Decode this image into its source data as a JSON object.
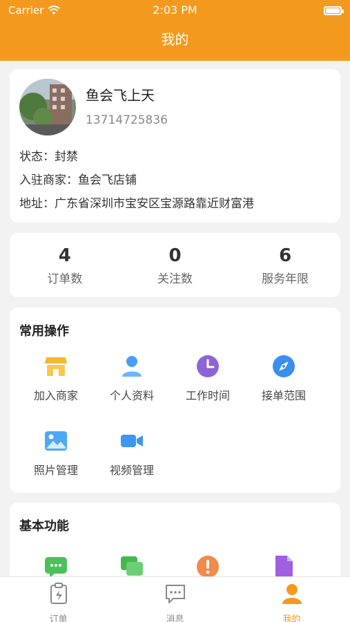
{
  "status_bar": {
    "carrier": "Carrier",
    "time": "2:03 PM"
  },
  "nav": {
    "title": "我的"
  },
  "profile": {
    "name": "鱼会飞上天",
    "phone": "13714725836",
    "status_line": "状态：封禁",
    "merchant_line": "入驻商家：鱼会飞店铺",
    "address_line": "地址：广东省深圳市宝安区宝源路靠近财富港"
  },
  "stats": [
    {
      "value": "4",
      "label": "订单数"
    },
    {
      "value": "0",
      "label": "关注数"
    },
    {
      "value": "6",
      "label": "服务年限"
    }
  ],
  "common_ops": {
    "title": "常用操作",
    "items": [
      {
        "label": "加入商家",
        "icon": "store-icon",
        "color": "#f7b731"
      },
      {
        "label": "个人资料",
        "icon": "user-icon",
        "color": "#4a9df5"
      },
      {
        "label": "工作时间",
        "icon": "clock-icon",
        "color": "#8e63d6"
      },
      {
        "label": "接单范围",
        "icon": "compass-icon",
        "color": "#3a8ef0"
      },
      {
        "label": "照片管理",
        "icon": "photo-icon",
        "color": "#4fa8f5"
      },
      {
        "label": "视频管理",
        "icon": "video-icon",
        "color": "#3c96f2"
      }
    ]
  },
  "basic_funcs": {
    "title": "基本功能",
    "items": [
      {
        "icon": "message-icon",
        "color": "#4cc05a"
      },
      {
        "icon": "chat-icon",
        "color": "#43b84f"
      },
      {
        "icon": "alert-icon",
        "color": "#f28a4a"
      },
      {
        "icon": "document-icon",
        "color": "#a05fe0"
      }
    ]
  },
  "tabbar": {
    "items": [
      {
        "label": "订单",
        "icon": "order-icon"
      },
      {
        "label": "消息",
        "icon": "message-icon"
      },
      {
        "label": "我的",
        "icon": "profile-icon",
        "active": true
      }
    ],
    "active_color": "#f39a1e"
  },
  "colors": {
    "brand": "#f39a1e",
    "background": "#f2f2f2"
  }
}
